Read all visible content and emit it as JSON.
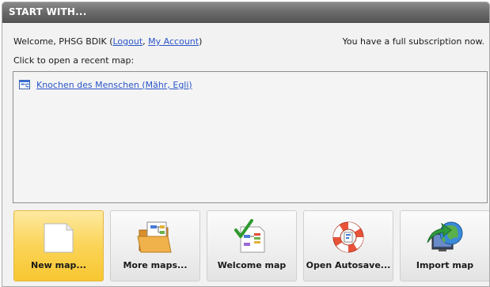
{
  "header": {
    "title": "START WITH..."
  },
  "account": {
    "welcome_prefix": "Welcome, PHSG BDIK",
    "open_paren": "(",
    "logout_label": "Logout",
    "separator": ",",
    "my_account_label": "My Account",
    "close_paren": ")",
    "subscription_status": "You have a full subscription now."
  },
  "recent": {
    "label": "Click to open a recent map:",
    "items": [
      {
        "title": "Knochen des Menschen (Mähr, Egli)",
        "icon": "mindmap-file-icon"
      }
    ]
  },
  "actions": [
    {
      "label": "New map...",
      "icon": "blank-page-icon",
      "highlighted": true
    },
    {
      "label": "More maps...",
      "icon": "folder-maps-icon",
      "highlighted": false
    },
    {
      "label": "Welcome map",
      "icon": "welcome-checklist-icon",
      "highlighted": false
    },
    {
      "label": "Open Autosave...",
      "icon": "lifebuoy-icon",
      "highlighted": false
    },
    {
      "label": "Import map",
      "icon": "import-globe-icon",
      "highlighted": false
    }
  ],
  "colors": {
    "header_bg": "#6a6a6a",
    "link": "#2a55c8",
    "highlight_tile": "#fbd457"
  }
}
